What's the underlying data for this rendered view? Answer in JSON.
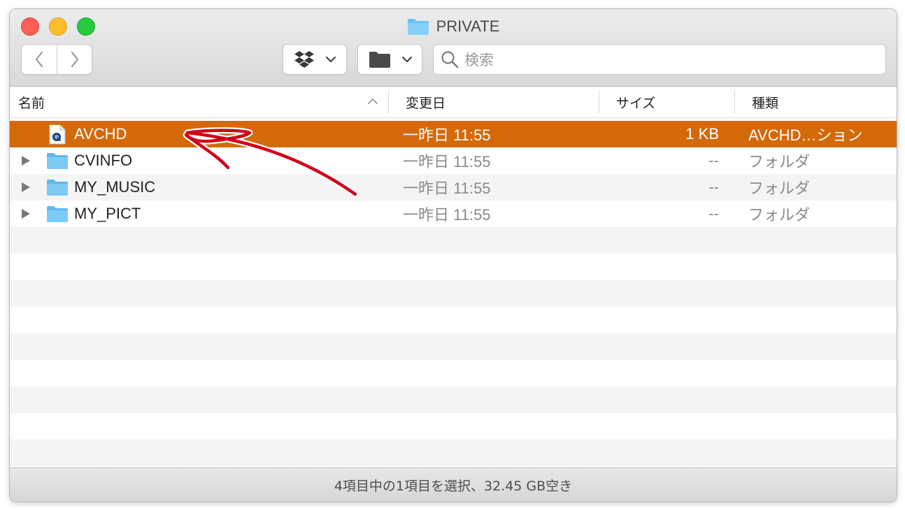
{
  "window": {
    "title": "PRIVATE"
  },
  "toolbar": {
    "back_icon": "chevron-left-icon",
    "forward_icon": "chevron-right-icon",
    "dropbox_icon": "dropbox-icon",
    "folder_icon": "folder-icon",
    "search_placeholder": "検索"
  },
  "columns": {
    "name": "名前",
    "date": "変更日",
    "size": "サイズ",
    "kind": "種類"
  },
  "files": [
    {
      "name": "AVCHD",
      "date": "一昨日 11:55",
      "size": "1 KB",
      "kind": "AVCHD…ション",
      "type": "file",
      "selected": true
    },
    {
      "name": "CVINFO",
      "date": "一昨日 11:55",
      "size": "--",
      "kind": "フォルダ",
      "type": "folder",
      "selected": false
    },
    {
      "name": "MY_MUSIC",
      "date": "一昨日 11:55",
      "size": "--",
      "kind": "フォルダ",
      "type": "folder",
      "selected": false
    },
    {
      "name": "MY_PICT",
      "date": "一昨日 11:55",
      "size": "--",
      "kind": "フォルダ",
      "type": "folder",
      "selected": false
    }
  ],
  "status": {
    "text": "4項目中の1項目を選択、32.45 GB空き"
  },
  "colors": {
    "selection": "#d4690a",
    "folder": "#6cc4f5",
    "annotation_arrow": "#d0021b"
  }
}
